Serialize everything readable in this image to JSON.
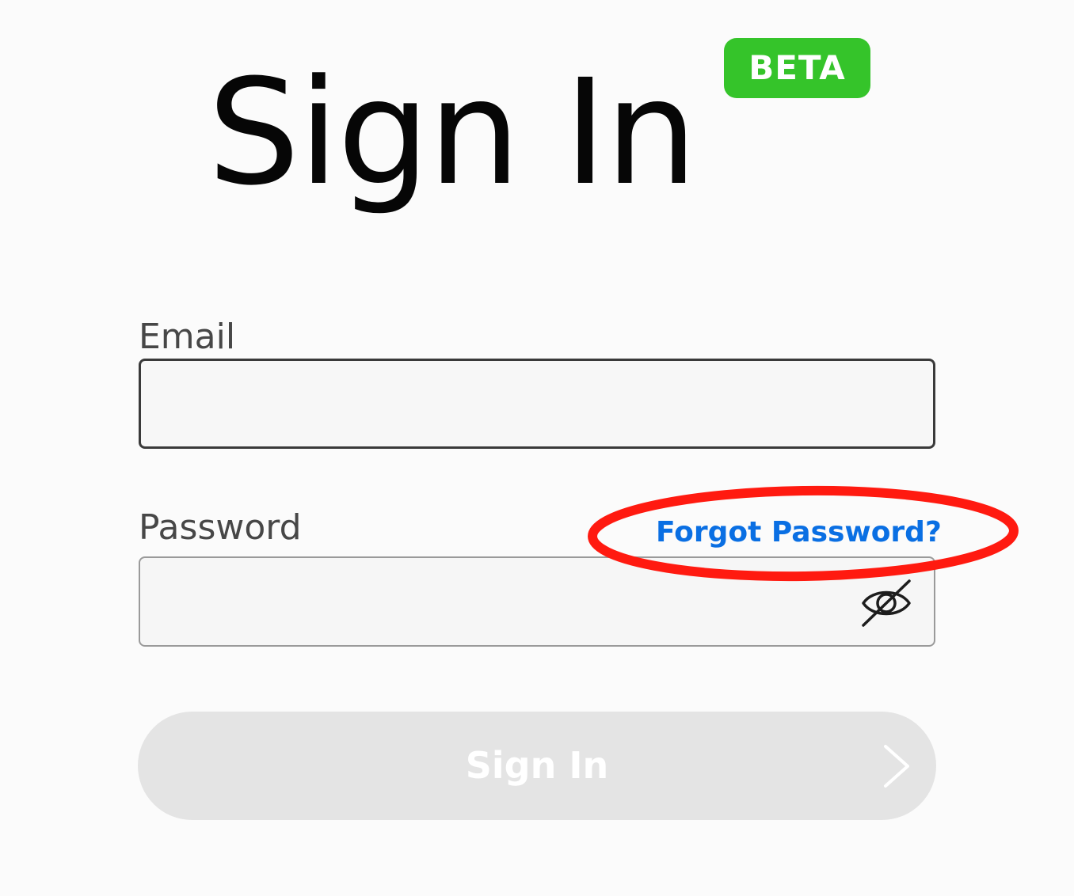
{
  "header": {
    "title": "Sign In",
    "badge": "BETA"
  },
  "form": {
    "email_label": "Email",
    "email_value": "",
    "password_label": "Password",
    "password_value": "",
    "forgot_password_label": "Forgot Password?",
    "password_visibility_icon": "eye-off-icon",
    "submit_label": "Sign In",
    "submit_icon": "chevron-right-icon"
  },
  "colors": {
    "badge_green": "#35c42a",
    "link_blue": "#0a6fe3",
    "highlight_red": "#ff1a10",
    "button_disabled": "#e4e4e4"
  }
}
